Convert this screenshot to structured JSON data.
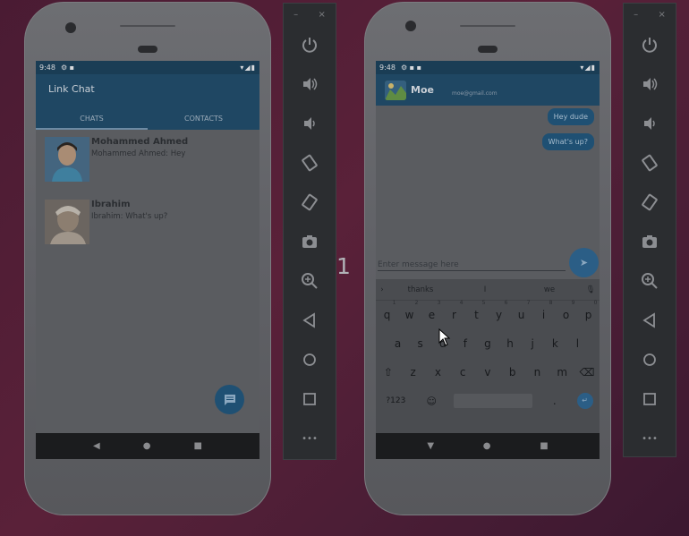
{
  "center_label": "1",
  "left_phone": {
    "status_time": "9:48",
    "status_icons": "▾◢▮",
    "app_title": "Link Chat",
    "tabs": [
      {
        "label": "CHATS",
        "active": true
      },
      {
        "label": "CONTACTS",
        "active": false
      }
    ],
    "chats": [
      {
        "name": "Mohammed Ahmed",
        "message": "Mohammed Ahmed: Hey"
      },
      {
        "name": "Ibrahim",
        "message": "Ibrahim: What's up?"
      }
    ],
    "nav": {
      "back": "◀",
      "home": "●",
      "recents": "■"
    }
  },
  "right_phone": {
    "status_time": "9:48",
    "status_icons": "▾◢▮",
    "contact_name": "Moe",
    "contact_email": "moe@gmail.com",
    "messages": [
      "Hey dude",
      "What's up?"
    ],
    "input_placeholder": "Enter message here",
    "suggestions": [
      "thanks",
      "I",
      "we"
    ],
    "keyboard": {
      "row1": [
        "q",
        "w",
        "e",
        "r",
        "t",
        "y",
        "u",
        "i",
        "o",
        "p"
      ],
      "row1_hints": [
        "1",
        "2",
        "3",
        "4",
        "5",
        "6",
        "7",
        "8",
        "9",
        "0"
      ],
      "row2": [
        "a",
        "s",
        "d",
        "f",
        "g",
        "h",
        "j",
        "k",
        "l"
      ],
      "row3": [
        "z",
        "x",
        "c",
        "v",
        "b",
        "n",
        "m"
      ],
      "symbols_key": "?123",
      "period_key": "."
    },
    "nav": {
      "back": "▼",
      "home": "●",
      "recents": "■"
    }
  },
  "emulator_toolbar": {
    "minimize": "–",
    "close": "×",
    "more": "•••"
  },
  "colors": {
    "accent": "#1f4763",
    "bubble": "#1f5073",
    "background": "#4a1b33"
  }
}
